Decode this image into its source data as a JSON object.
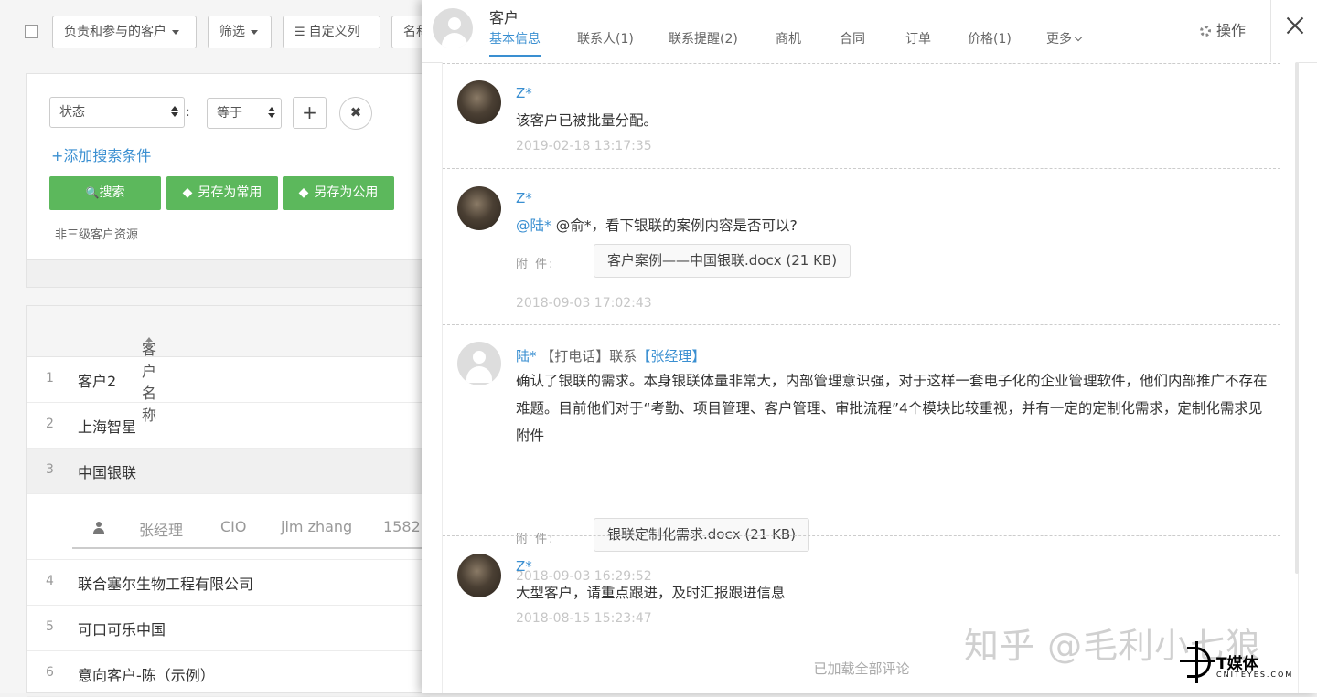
{
  "toolbar": {
    "owner_filter": "负责和参与的客户",
    "filter": "筛选",
    "custom_columns": "自定义列",
    "name_search_partial": "名称"
  },
  "search_panel": {
    "field_select": "状态",
    "operator_select": "等于",
    "add_condition": "+添加搜索条件",
    "search_button": "搜索",
    "save_common_button": "另存为常用",
    "save_public_button": "另存为公用",
    "saved_filter_name": "非三级客户资源"
  },
  "table": {
    "header_name": "客户名称",
    "rows": [
      {
        "index": "1",
        "name": "客户2"
      },
      {
        "index": "2",
        "name": "上海智星"
      },
      {
        "index": "3",
        "name": "中国银联"
      },
      {
        "index": "4",
        "name": "联合塞尔生物工程有限公司"
      },
      {
        "index": "5",
        "name": "可口可乐中国"
      },
      {
        "index": "6",
        "name": "意向客户-陈（示例）"
      }
    ],
    "contact_row": {
      "name": "张经理",
      "title": "CIO",
      "english_name": "jim zhang",
      "phone_partial": "1582"
    }
  },
  "drawer": {
    "title": "客户",
    "tabs": [
      {
        "label": "基本信息",
        "active": true
      },
      {
        "label": "联系人(1)"
      },
      {
        "label": "联系提醒(2)"
      },
      {
        "label": "商机"
      },
      {
        "label": "合同"
      },
      {
        "label": "订单"
      },
      {
        "label": "价格(1)"
      },
      {
        "label": "更多"
      }
    ],
    "operations": "操作",
    "attachment_label": "附 件:",
    "comments": [
      {
        "author": "Z*",
        "text": "该客户已被批量分配。",
        "time": "2019-02-18 13:17:35"
      },
      {
        "author": "Z*",
        "mention": "@陆*",
        "text": " @俞*，看下银联的案例内容是否可以?",
        "attachment": "客户案例——中国银联.docx (21 KB)",
        "time": "2018-09-03 17:02:43"
      },
      {
        "author": "陆*",
        "action": "【打电话】联系",
        "contact": "【张经理】",
        "text": "确认了银联的需求。本身银联体量非常大，内部管理意识强，对于这样一套电子化的企业管理软件，他们内部推广不存在难题。目前他们对于“考勤、项目管理、客户管理、审批流程”4个模块比较重视，并有一定的定制化需求，定制化需求见附件",
        "attachment": "银联定制化需求.docx (21 KB)",
        "time": "2018-09-03 16:29:52"
      },
      {
        "author": "Z*",
        "text": "大型客户，请重点跟进，及时汇报跟进信息",
        "time": "2018-08-15 15:23:47"
      }
    ],
    "loaded_all": "已加载全部评论"
  },
  "watermark": {
    "zhihu": "知乎 @毛利小七狼",
    "logo_title": "T媒体",
    "logo_sub": "CNITEYES.COM"
  },
  "colors": {
    "accent": "#3a8fd1",
    "green": "#5cb85c"
  }
}
